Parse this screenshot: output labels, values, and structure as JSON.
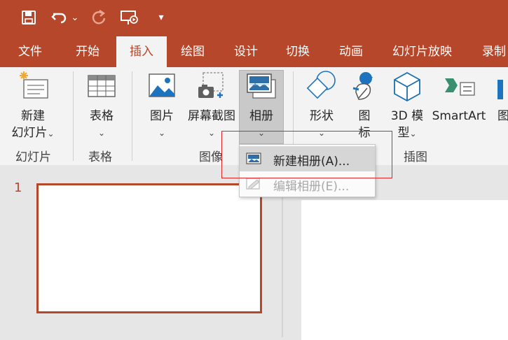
{
  "qat": {
    "dropdown_glyph": "▾",
    "undo_arrow": "▾"
  },
  "tabs": [
    {
      "label": "文件"
    },
    {
      "label": "开始"
    },
    {
      "label": "插入"
    },
    {
      "label": "绘图"
    },
    {
      "label": "设计"
    },
    {
      "label": "切换"
    },
    {
      "label": "动画"
    },
    {
      "label": "幻灯片放映"
    },
    {
      "label": "录制"
    }
  ],
  "ribbon": {
    "new_slide": {
      "line1": "新建",
      "line2": "幻灯片"
    },
    "table": {
      "label": "表格"
    },
    "picture": {
      "label": "图片"
    },
    "screenshot": {
      "label": "屏幕截图"
    },
    "album": {
      "label": "相册"
    },
    "shapes": {
      "label": "形状"
    },
    "icons": {
      "line1": "图",
      "line2": "标"
    },
    "model3d": {
      "line1": "3D 模",
      "line2": "型"
    },
    "smartart": {
      "label": "SmartArt"
    },
    "chart_partial": {
      "label": "图"
    },
    "chevron": "⌄",
    "groups": {
      "slides": "幻灯片",
      "tables": "表格",
      "images": "图像",
      "illustrations": "插图"
    }
  },
  "dropdown": {
    "new_album": "新建相册(A)...",
    "edit_album": "编辑相册(E)..."
  },
  "slides": {
    "number": "1"
  },
  "colors": {
    "accent": "#b7472a",
    "highlight_box": "#e0262b"
  }
}
